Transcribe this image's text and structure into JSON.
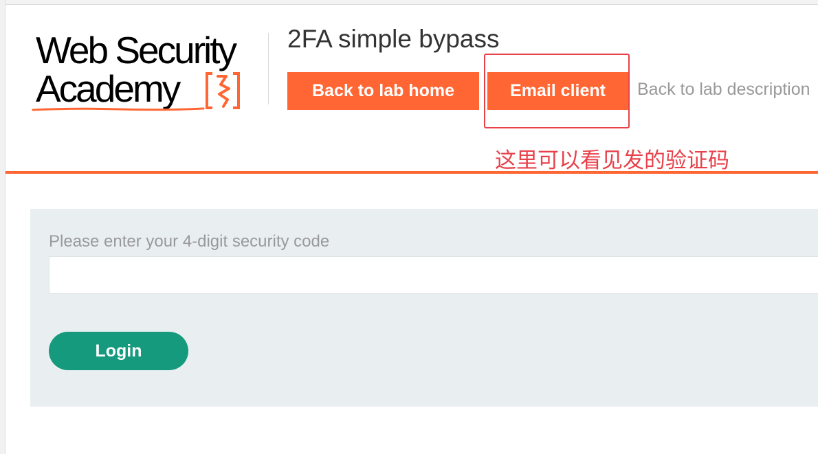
{
  "logo": {
    "line1": "Web Security",
    "line2": "Academy"
  },
  "lab": {
    "title": "2FA simple bypass"
  },
  "nav": {
    "back_to_lab_home": "Back to lab home",
    "email_client": "Email client",
    "back_to_lab_description": "Back to lab description"
  },
  "annotation": {
    "note": "这里可以看见发的验证码"
  },
  "form": {
    "code_label": "Please enter your 4-digit security code",
    "code_value": "",
    "login_label": "Login"
  },
  "colors": {
    "brand_orange": "#ff6633",
    "login_green": "#169a7e",
    "annotation_red": "#e8414a",
    "panel_background": "#e9eff1"
  }
}
